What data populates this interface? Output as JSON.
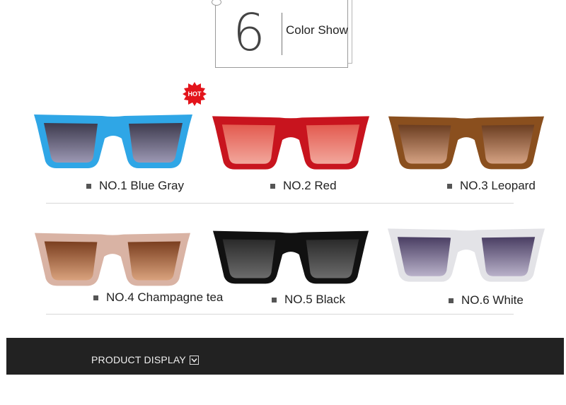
{
  "header": {
    "number": "6",
    "title": "Color Show"
  },
  "hot_badge": "HOT",
  "products": [
    {
      "label": "NO.1 Blue Gray",
      "frame_color": "#2fa6e6",
      "lens_top": "#3d3a4d",
      "lens_bottom": "#9c98b4"
    },
    {
      "label": "NO.2 Red",
      "frame_color": "#c8141e",
      "lens_top": "#e35a4f",
      "lens_bottom": "#f2a79c"
    },
    {
      "label": "NO.3 Leopard",
      "frame_color": "#8a4f1e",
      "lens_top": "#6b3d20",
      "lens_bottom": "#d5a283"
    },
    {
      "label": "NO.4 Champagne tea",
      "frame_color": "#d9b3a4",
      "lens_top": "#7a3e1f",
      "lens_bottom": "#d9a27d"
    },
    {
      "label": "NO.5 Black",
      "frame_color": "#111111",
      "lens_top": "#2a2a2a",
      "lens_bottom": "#6b6b6b"
    },
    {
      "label": "NO.6 White",
      "frame_color": "#e3e3e7",
      "lens_top": "#4a3e63",
      "lens_bottom": "#b9b1c9"
    }
  ],
  "section": {
    "title": "PRODUCT DISPLAY"
  }
}
